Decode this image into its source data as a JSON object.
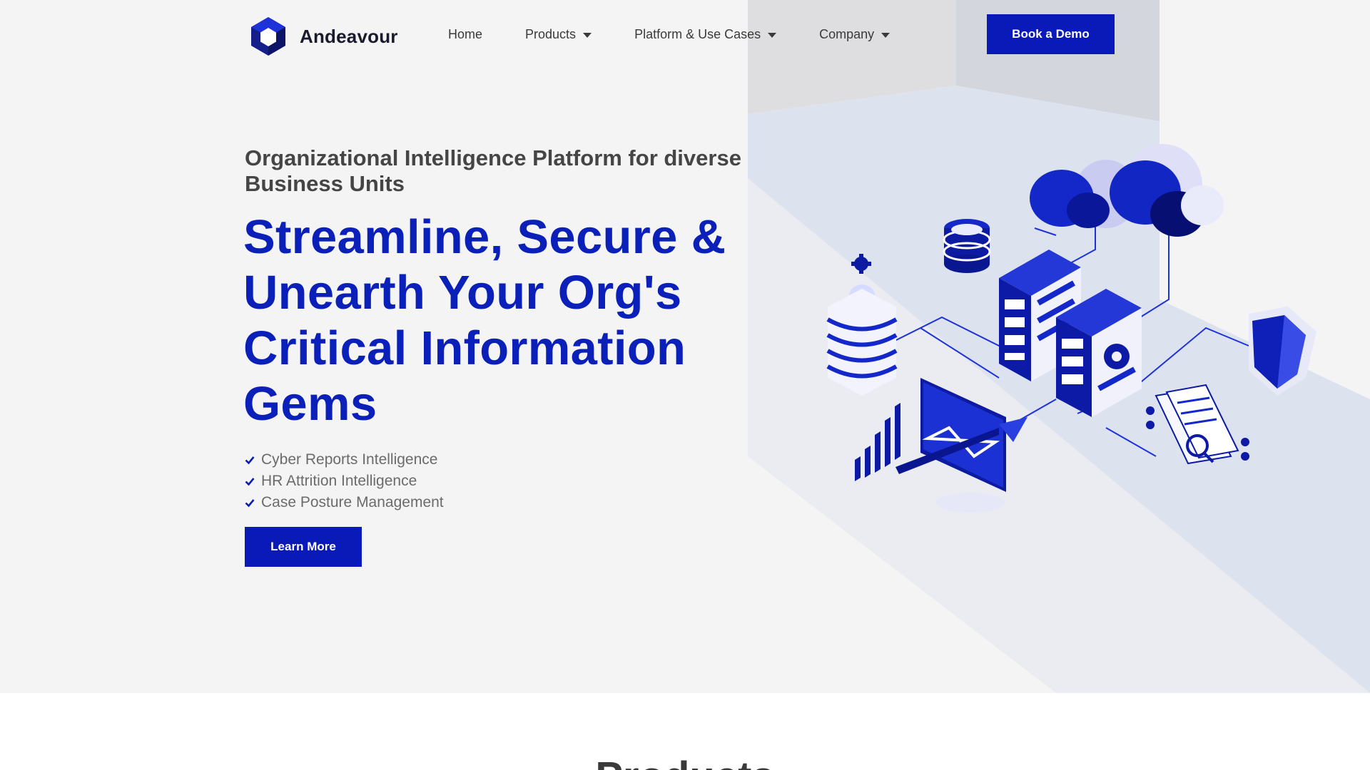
{
  "brand": {
    "name": "Andeavour",
    "primary_color": "#0a1ab8"
  },
  "nav": {
    "items": [
      {
        "label": "Home",
        "has_dropdown": false
      },
      {
        "label": "Products",
        "has_dropdown": true
      },
      {
        "label": "Platform & Use Cases",
        "has_dropdown": true
      },
      {
        "label": "Company",
        "has_dropdown": true
      }
    ],
    "cta_label": "Book a Demo"
  },
  "hero": {
    "subtitle": "Organizational Intelligence Platform for diverse Business Units",
    "headline": "Streamline, Secure & Unearth Your Org's Critical Information Gems",
    "features": [
      "Cyber Reports Intelligence",
      "HR Attrition Intelligence",
      "Case Posture Management"
    ],
    "cta_label": "Learn More",
    "illustration_icons": [
      "cloud-icon",
      "database-icon",
      "server-icon",
      "gear-icon",
      "shield-icon",
      "monitor-chart-icon",
      "documents-icon"
    ]
  },
  "products_section": {
    "title": "Products"
  }
}
